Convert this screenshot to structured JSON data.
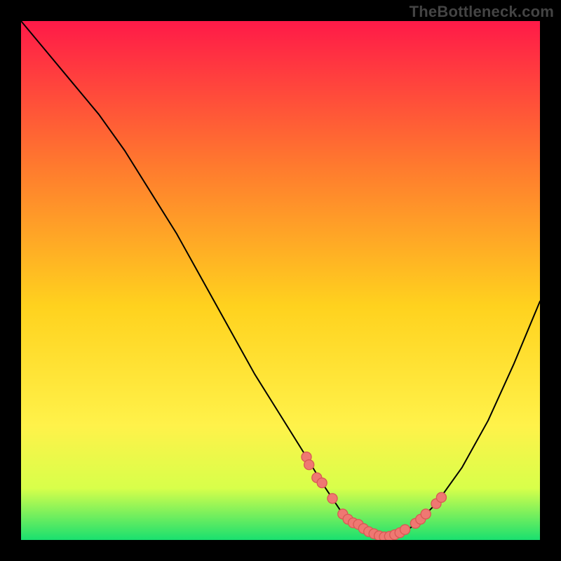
{
  "watermark": "TheBottleneck.com",
  "colors": {
    "frame": "#000000",
    "curve": "#000000",
    "dot_fill": "#ef7872",
    "dot_stroke": "#d85a55",
    "grad_top": "#ff1a48",
    "grad_mid1": "#ff7a2e",
    "grad_mid2": "#ffd21e",
    "grad_mid3": "#fff24a",
    "grad_mid4": "#d8ff4a",
    "grad_bottom": "#19e06f"
  },
  "chart_data": {
    "type": "line",
    "title": "",
    "xlabel": "",
    "ylabel": "",
    "xlim": [
      0,
      100
    ],
    "ylim": [
      0,
      100
    ],
    "series": [
      {
        "name": "bottleneck-curve",
        "x": [
          0,
          5,
          10,
          15,
          20,
          25,
          30,
          35,
          40,
          45,
          50,
          55,
          58,
          60,
          62,
          65,
          68,
          70,
          73,
          76,
          80,
          85,
          90,
          95,
          100
        ],
        "y": [
          100,
          94,
          88,
          82,
          75,
          67,
          59,
          50,
          41,
          32,
          24,
          16,
          11,
          8,
          5,
          3,
          1,
          0.5,
          1,
          3,
          7,
          14,
          23,
          34,
          46
        ]
      }
    ],
    "scatter": {
      "name": "highlighted-points",
      "x": [
        55,
        55.5,
        57,
        58,
        60,
        62,
        63,
        64,
        65,
        66,
        67,
        68,
        69,
        70,
        71,
        72,
        73,
        74,
        76,
        77,
        78,
        80,
        81
      ],
      "y": [
        16,
        14.5,
        12,
        11,
        8,
        5,
        4,
        3.3,
        3,
        2.2,
        1.6,
        1.2,
        0.8,
        0.6,
        0.7,
        1,
        1.4,
        2,
        3.2,
        4,
        5,
        7,
        8.2
      ]
    }
  }
}
